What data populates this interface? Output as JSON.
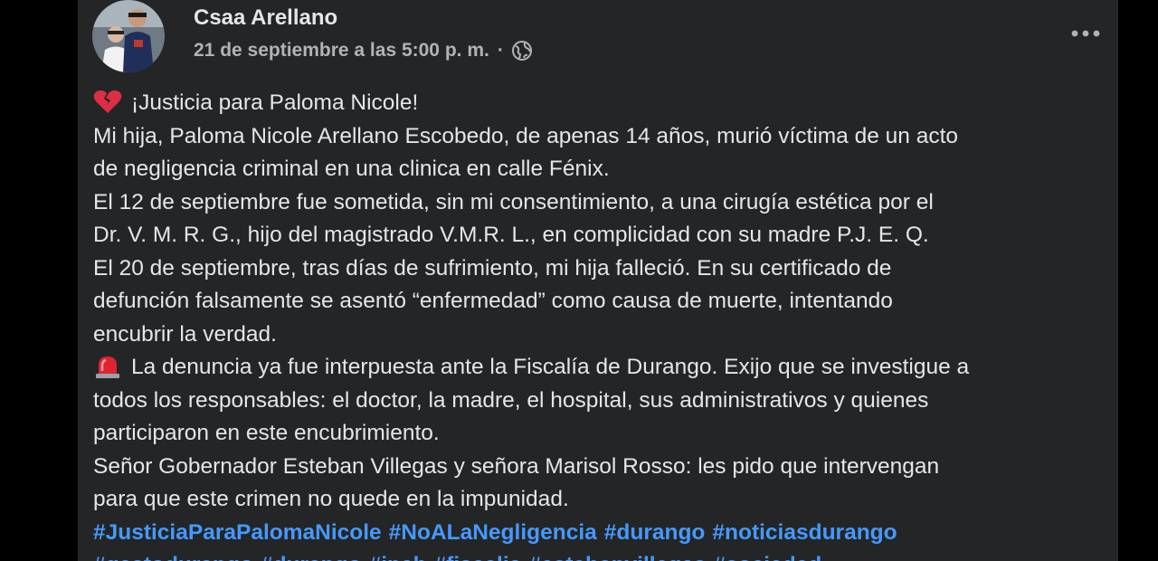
{
  "post": {
    "author": "Csaa Arellano",
    "timestamp": "21 de septiembre a las 5:00 p. m.",
    "separator": "·",
    "privacy_icon": "globe-icon",
    "more_icon": "more-horizontal-icon",
    "avatar": "profile-photo",
    "colors": {
      "card_bg": "#242526",
      "text": "#e4e6eb",
      "secondary": "#b0b3b8",
      "link": "#4599ff"
    },
    "lines": [
      {
        "emoji": "broken-heart-icon",
        "text": "¡Justicia para Paloma Nicole!"
      },
      {
        "text": "Mi hija, Paloma Nicole Arellano Escobedo, de apenas 14 años, murió víctima de un acto"
      },
      {
        "text": "de negligencia criminal en una clinica en calle Fénix."
      },
      {
        "text": "El 12 de septiembre fue sometida, sin mi consentimiento, a una cirugía estética por el"
      },
      {
        "text": "Dr. V. M. R. G., hijo del magistrado V.M.R. L., en complicidad con su madre P.J. E. Q."
      },
      {
        "text": "El 20 de septiembre, tras días de sufrimiento, mi hija falleció. En su certificado de"
      },
      {
        "text": "defunción falsamente se asentó “enfermedad” como causa de muerte, intentando"
      },
      {
        "text": "encubrir la verdad."
      },
      {
        "emoji": "siren-icon",
        "text": "La denuncia ya fue interpuesta ante la Fiscalía de Durango. Exijo que se investigue a"
      },
      {
        "text": "todos los responsables: el doctor, la madre, el hospital, sus administrativos y quienes"
      },
      {
        "text": "participaron en este encubrimiento."
      },
      {
        "text": "Señor Gobernador Esteban Villegas y señora Marisol Rosso: les pido que intervengan"
      },
      {
        "text": "para que este crimen no quede en la impunidad."
      }
    ],
    "hashtags": [
      "#JusticiaParaPalomaNicole",
      "#NoALaNegligencia",
      "#durango",
      "#noticiasdurango"
    ],
    "hashtags_cut": [
      "#gestodurango",
      "#durango",
      "#inah",
      "#fiscalia",
      "#estebanvillegas",
      "#sociedad"
    ]
  }
}
